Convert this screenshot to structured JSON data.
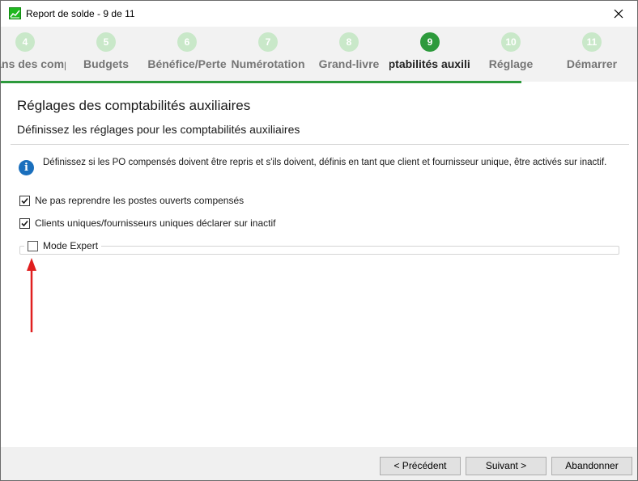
{
  "window": {
    "title": "Report de solde - 9 de 11",
    "close_glyph": "✕"
  },
  "steps": [
    {
      "number": "4",
      "label": "Plans des comptes",
      "state": "done"
    },
    {
      "number": "5",
      "label": "Budgets",
      "state": "done"
    },
    {
      "number": "6",
      "label": "Bénéfice/Perte",
      "state": "done"
    },
    {
      "number": "7",
      "label": "Numérotation",
      "state": "done"
    },
    {
      "number": "8",
      "label": "Grand-livre",
      "state": "done"
    },
    {
      "number": "9",
      "label": "Comptabilités auxiliaires",
      "state": "active"
    },
    {
      "number": "10",
      "label": "Réglage",
      "state": "pending"
    },
    {
      "number": "11",
      "label": "Démarrer",
      "state": "pending"
    }
  ],
  "page": {
    "title": "Réglages des comptabilités auxiliaires",
    "subtitle": "Définissez les réglages pour les comptabilités auxiliaires"
  },
  "info": {
    "icon": "info-icon",
    "text": "Définissez si les PO compensés doivent être repris et s'ils doivent, définis en tant que client et fournisseur unique, être activés sur inactif."
  },
  "options": {
    "no_reprise": {
      "label": "Ne pas reprendre les postes ouverts compensés",
      "checked": true
    },
    "clients_uniques": {
      "label": "Clients uniques/fournisseurs uniques déclarer sur inactif",
      "checked": true
    },
    "mode_expert": {
      "label": "Mode Expert",
      "checked": false
    }
  },
  "footer": {
    "prev_label": "< Précédent",
    "next_label": "Suivant >",
    "cancel_label": "Abandonner"
  },
  "colors": {
    "accent_green": "#2d9a3c",
    "pending_step": "#c9e8c9",
    "annotation_arrow": "#e01f1f",
    "info_blue": "#1a6fbd"
  }
}
